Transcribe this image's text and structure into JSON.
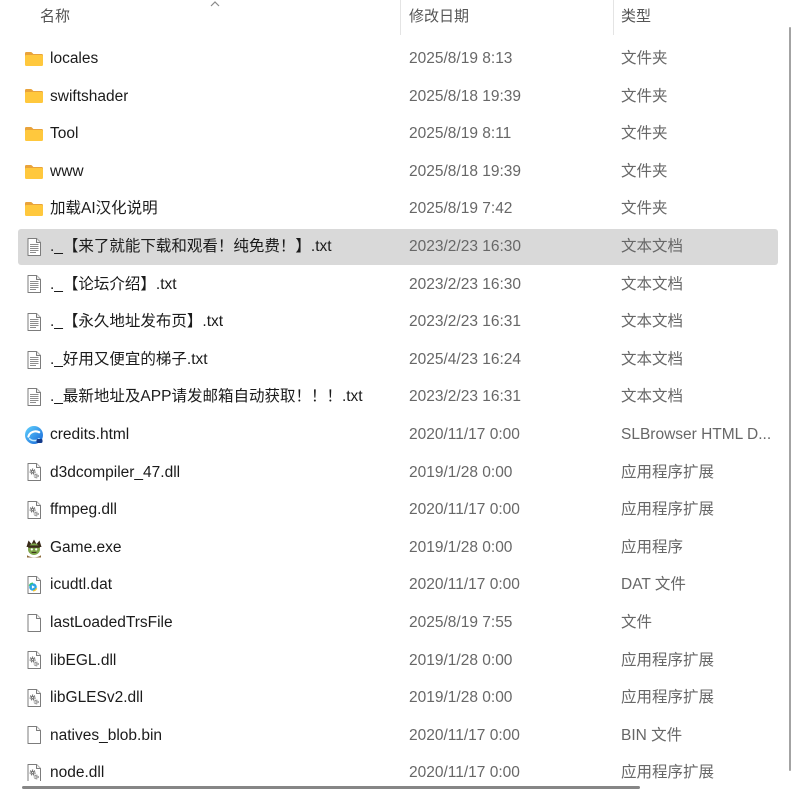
{
  "header": {
    "columns": [
      {
        "label": "名称"
      },
      {
        "label": "修改日期"
      },
      {
        "label": "类型"
      }
    ],
    "sort_icon": "chevron-up-icon"
  },
  "files": [
    {
      "name": "locales",
      "modified": "2025/8/19 8:13",
      "type": "文件夹",
      "icon": "folder-icon"
    },
    {
      "name": "swiftshader",
      "modified": "2025/8/18 19:39",
      "type": "文件夹",
      "icon": "folder-icon"
    },
    {
      "name": "Tool",
      "modified": "2025/8/19 8:11",
      "type": "文件夹",
      "icon": "folder-icon"
    },
    {
      "name": "www",
      "modified": "2025/8/18 19:39",
      "type": "文件夹",
      "icon": "folder-icon"
    },
    {
      "name": "加载AI汉化说明",
      "modified": "2025/8/19 7:42",
      "type": "文件夹",
      "icon": "folder-icon"
    },
    {
      "name": "._【来了就能下载和观看！纯免费！】.txt",
      "modified": "2023/2/23 16:30",
      "type": "文本文档",
      "icon": "text-file-icon",
      "selected": true
    },
    {
      "name": "._【论坛介绍】.txt",
      "modified": "2023/2/23 16:30",
      "type": "文本文档",
      "icon": "text-file-icon"
    },
    {
      "name": "._【永久地址发布页】.txt",
      "modified": "2023/2/23 16:31",
      "type": "文本文档",
      "icon": "text-file-icon"
    },
    {
      "name": "._好用又便宜的梯子.txt",
      "modified": "2025/4/23 16:24",
      "type": "文本文档",
      "icon": "text-file-icon"
    },
    {
      "name": "._最新地址及APP请发邮箱自动获取！！！.txt",
      "modified": "2023/2/23 16:31",
      "type": "文本文档",
      "icon": "text-file-icon"
    },
    {
      "name": "credits.html",
      "modified": "2020/11/17 0:00",
      "type": "SLBrowser HTML D...",
      "icon": "browser-html-icon"
    },
    {
      "name": "d3dcompiler_47.dll",
      "modified": "2019/1/28 0:00",
      "type": "应用程序扩展",
      "icon": "dll-file-icon"
    },
    {
      "name": "ffmpeg.dll",
      "modified": "2020/11/17 0:00",
      "type": "应用程序扩展",
      "icon": "dll-file-icon"
    },
    {
      "name": "Game.exe",
      "modified": "2019/1/28 0:00",
      "type": "应用程序",
      "icon": "game-exe-icon"
    },
    {
      "name": "icudtl.dat",
      "modified": "2020/11/17 0:00",
      "type": "DAT 文件",
      "icon": "dat-file-icon"
    },
    {
      "name": "lastLoadedTrsFile",
      "modified": "2025/8/19 7:55",
      "type": "文件",
      "icon": "blank-file-icon"
    },
    {
      "name": "libEGL.dll",
      "modified": "2019/1/28 0:00",
      "type": "应用程序扩展",
      "icon": "dll-file-icon"
    },
    {
      "name": "libGLESv2.dll",
      "modified": "2019/1/28 0:00",
      "type": "应用程序扩展",
      "icon": "dll-file-icon"
    },
    {
      "name": "natives_blob.bin",
      "modified": "2020/11/17 0:00",
      "type": "BIN 文件",
      "icon": "blank-file-icon"
    },
    {
      "name": "node.dll",
      "modified": "2020/11/17 0:00",
      "type": "应用程序扩展",
      "icon": "dll-file-icon"
    }
  ],
  "colors": {
    "selected_row": "#d9d9d9",
    "name_text": "#1b1b1b",
    "meta_text": "#676767",
    "folder": "#FFC83D"
  }
}
